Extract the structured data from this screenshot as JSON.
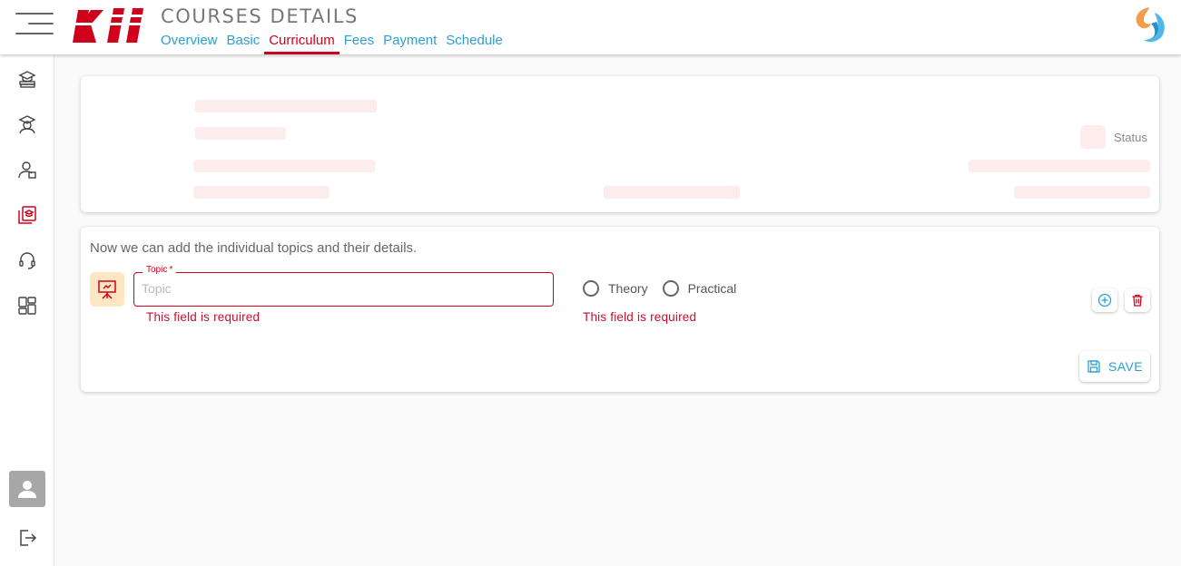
{
  "header": {
    "logo_text": "Kii",
    "title": "COURSES DETAILS",
    "tabs": [
      {
        "label": "Overview",
        "active": false
      },
      {
        "label": "Basic",
        "active": false
      },
      {
        "label": "Curriculum",
        "active": true
      },
      {
        "label": "Fees",
        "active": false
      },
      {
        "label": "Payment",
        "active": false
      },
      {
        "label": "Schedule",
        "active": false
      }
    ]
  },
  "sidebar": {
    "items": [
      {
        "icon": "graduation-books-icon"
      },
      {
        "icon": "student-icon"
      },
      {
        "icon": "teacher-icon"
      },
      {
        "icon": "courses-icon",
        "active": true
      },
      {
        "icon": "headset-icon"
      },
      {
        "icon": "dashboard-grid-icon"
      }
    ],
    "user": {
      "icon": "user-avatar-icon"
    },
    "logout": {
      "icon": "logout-icon"
    }
  },
  "summary_card": {
    "status_label": "Status"
  },
  "curriculum_card": {
    "intro": "Now we can add the individual topics and their details.",
    "topic": {
      "label": "Topic",
      "required_mark": "*",
      "placeholder": "Topic",
      "value": "",
      "error": "This field is required"
    },
    "type": {
      "options": [
        "Theory",
        "Practical"
      ],
      "error": "This field is required"
    },
    "save_label": "SAVE"
  },
  "colors": {
    "accent_blue": "#2a9fd6",
    "active_red": "#d0021b",
    "error_red": "#c8102e",
    "skeleton": "#fdecec"
  }
}
